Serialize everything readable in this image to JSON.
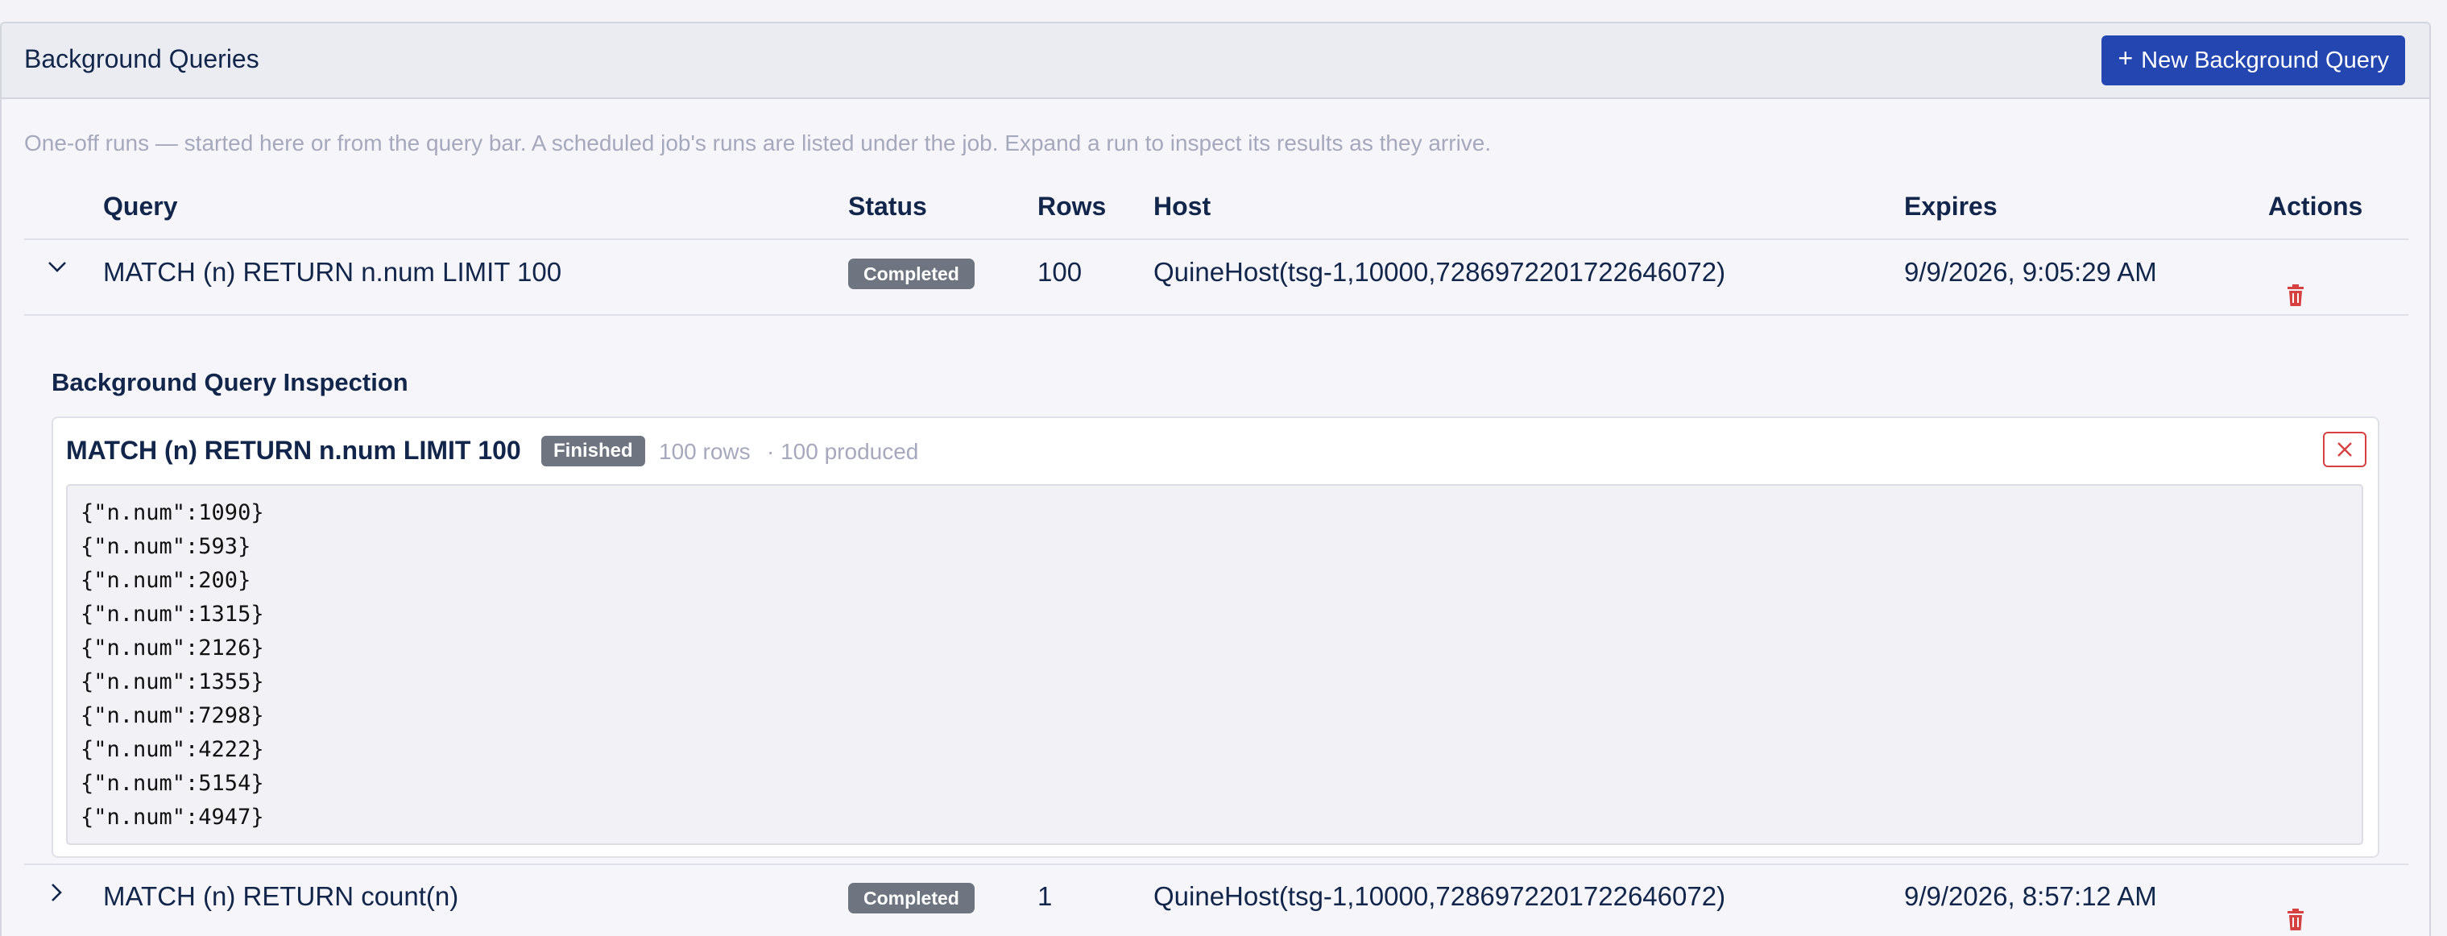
{
  "header": {
    "title": "Background Queries",
    "new_button_label": "New Background Query"
  },
  "description": "One-off runs — started here or from the query bar. A scheduled job's runs are listed under the job. Expand a run to inspect its results as they arrive.",
  "table": {
    "columns": [
      "Query",
      "Status",
      "Rows",
      "Host",
      "Expires",
      "Actions"
    ],
    "rows": [
      {
        "query": "MATCH (n) RETURN n.num LIMIT 100",
        "status": "Completed",
        "rows": "100",
        "host": "QuineHost(tsg-1,10000,7286972201722646072)",
        "expires": "9/9/2026, 9:05:29 AM",
        "expanded": true
      },
      {
        "query": "MATCH (n) RETURN count(n)",
        "status": "Completed",
        "rows": "1",
        "host": "QuineHost(tsg-1,10000,7286972201722646072)",
        "expires": "9/9/2026, 8:57:12 AM",
        "expanded": false
      }
    ]
  },
  "inspection": {
    "title": "Background Query Inspection",
    "query": "MATCH (n) RETURN n.num LIMIT 100",
    "status": "Finished",
    "rows_text": "100 rows",
    "produced_text": "· 100 produced",
    "results": [
      "{\"n.num\":1090}",
      "{\"n.num\":593}",
      "{\"n.num\":200}",
      "{\"n.num\":1315}",
      "{\"n.num\":2126}",
      "{\"n.num\":1355}",
      "{\"n.num\":7298}",
      "{\"n.num\":4222}",
      "{\"n.num\":5154}",
      "{\"n.num\":4947}"
    ]
  },
  "icons": {
    "plus": "plus-icon",
    "expand": "chevron-down-icon",
    "collapse": "chevron-right-icon",
    "delete": "trash-icon",
    "close": "close-icon"
  },
  "colors": {
    "primary": "#2446b0",
    "badge": "#6e7580",
    "danger": "#d64040",
    "muted": "#a6a9bd"
  }
}
